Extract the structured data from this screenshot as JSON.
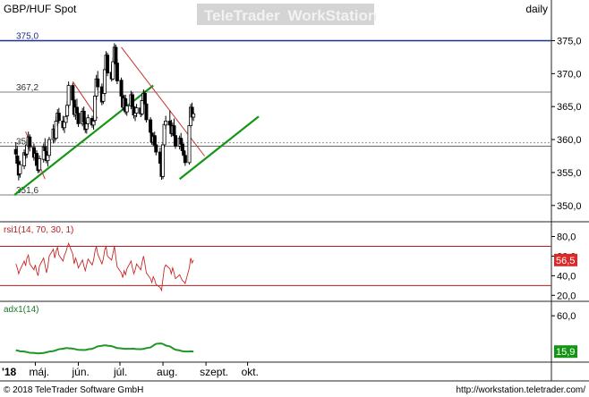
{
  "header": {
    "symbol_title": "GBP/HUF Spot",
    "interval": "daily",
    "watermark_a": "TeleTrader",
    "watermark_b": "WorkStation"
  },
  "footer": {
    "copyright": "© 2018 TeleTrader Software GmbH",
    "url": "http://workstation.teletrader.com/"
  },
  "colors": {
    "candle_up": "#ffffff",
    "candle_down": "#000000",
    "trend_green": "#149614",
    "trend_red": "#c83232",
    "level_blue": "#1f2f8a",
    "level_grey": "#555555",
    "rsi_line": "#c82828",
    "rsi_bounds": "#b41e1e",
    "adx_line": "#1e9628",
    "rsi_badge": "#dc2828",
    "adx_badge": "#149614"
  },
  "chart_data": [
    {
      "type": "candlestick",
      "panel": "price",
      "title": "GBP/HUF Spot",
      "ylim": [
        347.8,
        377.1
      ],
      "y_ticks": [
        "350,0",
        "355,0",
        "360,0",
        "365,0",
        "370,0",
        "375,0"
      ],
      "x_ticks": [
        "'18",
        "máj.",
        "jún.",
        "júl.",
        "aug.",
        "szept.",
        "okt."
      ],
      "level_labels": [
        {
          "value": 375.0,
          "text": "375,0"
        },
        {
          "value": 367.2,
          "text": "367,2"
        },
        {
          "value": 359.0,
          "text": "359"
        },
        {
          "value": 351.6,
          "text": "351,6"
        }
      ],
      "grid_line": 359.5,
      "trendlines": [
        {
          "color": "green",
          "from": [
            "2018-04-16",
            351.6
          ],
          "to": [
            "2018-07-25",
            368.2
          ]
        },
        {
          "color": "green",
          "from": [
            "2018-08-13",
            354.0
          ],
          "to": [
            "2018-10-09",
            363.5
          ]
        },
        {
          "color": "red",
          "from": [
            "2018-04-24",
            361.2
          ],
          "to": [
            "2018-05-08",
            354.0
          ]
        },
        {
          "color": "red",
          "from": [
            "2018-05-28",
            368.8
          ],
          "to": [
            "2018-06-15",
            363.2
          ]
        },
        {
          "color": "red",
          "from": [
            "2018-07-02",
            374.0
          ],
          "to": [
            "2018-08-31",
            357.5
          ]
        }
      ],
      "ohlc": [
        [
          358.5,
          359.6,
          357.2,
          357.8
        ],
        [
          357.5,
          359.0,
          356.0,
          356.4
        ],
        [
          356.6,
          357.5,
          353.8,
          354.6
        ],
        [
          354.8,
          356.8,
          354.2,
          356.2
        ],
        [
          356.0,
          358.5,
          355.5,
          358.0
        ],
        [
          358.0,
          359.2,
          357.0,
          357.6
        ],
        [
          357.8,
          359.8,
          357.2,
          359.2
        ],
        [
          359.0,
          361.2,
          358.5,
          360.4
        ],
        [
          360.4,
          360.8,
          358.2,
          358.9
        ],
        [
          358.8,
          359.4,
          356.8,
          357.3
        ],
        [
          357.2,
          358.6,
          356.0,
          357.9
        ],
        [
          357.9,
          358.4,
          355.6,
          356.1
        ],
        [
          356.0,
          357.2,
          354.9,
          355.3
        ],
        [
          355.4,
          357.6,
          355.0,
          357.1
        ],
        [
          357.0,
          359.4,
          356.5,
          358.9
        ],
        [
          358.8,
          360.2,
          357.8,
          358.3
        ],
        [
          358.2,
          359.0,
          356.4,
          356.8
        ],
        [
          356.8,
          358.2,
          355.9,
          357.6
        ],
        [
          357.6,
          360.4,
          357.2,
          360.0
        ],
        [
          360.0,
          362.3,
          359.4,
          361.6
        ],
        [
          361.5,
          362.0,
          359.6,
          360.2
        ],
        [
          360.2,
          363.4,
          359.9,
          362.8
        ],
        [
          362.8,
          364.6,
          362.0,
          364.0
        ],
        [
          364.0,
          364.8,
          362.4,
          362.9
        ],
        [
          362.8,
          363.6,
          361.4,
          361.8
        ],
        [
          361.8,
          363.2,
          361.0,
          362.7
        ],
        [
          362.6,
          364.0,
          362.0,
          363.5
        ],
        [
          363.6,
          365.8,
          363.0,
          365.2
        ],
        [
          365.2,
          368.8,
          364.8,
          368.2
        ],
        [
          368.2,
          368.6,
          365.6,
          366.0
        ],
        [
          366.0,
          366.6,
          363.4,
          363.8
        ],
        [
          363.8,
          365.4,
          363.0,
          364.9
        ],
        [
          364.9,
          366.2,
          363.6,
          364.0
        ],
        [
          364.0,
          364.6,
          361.9,
          362.4
        ],
        [
          362.4,
          364.8,
          362.0,
          364.3
        ],
        [
          364.3,
          365.0,
          362.2,
          362.6
        ],
        [
          362.6,
          363.4,
          361.0,
          361.5
        ],
        [
          361.6,
          363.0,
          360.9,
          362.4
        ],
        [
          362.4,
          363.8,
          361.9,
          363.3
        ],
        [
          363.2,
          363.6,
          361.8,
          362.2
        ],
        [
          362.2,
          363.4,
          361.5,
          362.8
        ],
        [
          362.9,
          367.0,
          362.5,
          366.6
        ],
        [
          366.6,
          369.8,
          366.0,
          369.2
        ],
        [
          369.2,
          370.4,
          367.5,
          368.0
        ],
        [
          368.0,
          368.5,
          365.2,
          365.7
        ],
        [
          365.8,
          367.4,
          365.4,
          367.0
        ],
        [
          367.0,
          371.2,
          366.6,
          370.6
        ],
        [
          370.6,
          373.4,
          370.0,
          372.8
        ],
        [
          372.8,
          373.2,
          369.6,
          370.1
        ],
        [
          370.2,
          371.4,
          368.8,
          369.2
        ],
        [
          369.2,
          372.4,
          369.0,
          371.8
        ],
        [
          371.8,
          374.6,
          371.4,
          374.0
        ],
        [
          374.0,
          374.4,
          371.0,
          371.5
        ],
        [
          371.6,
          372.2,
          368.4,
          368.9
        ],
        [
          369.0,
          369.4,
          366.2,
          366.6
        ],
        [
          366.6,
          367.0,
          364.4,
          364.9
        ],
        [
          364.8,
          366.8,
          364.4,
          366.3
        ],
        [
          366.2,
          366.8,
          363.8,
          364.2
        ],
        [
          364.2,
          365.6,
          363.6,
          365.1
        ],
        [
          365.1,
          367.4,
          364.6,
          366.8
        ],
        [
          366.8,
          367.2,
          364.6,
          365.0
        ],
        [
          365.0,
          365.8,
          363.2,
          363.7
        ],
        [
          363.6,
          364.4,
          362.8,
          364.0
        ],
        [
          364.0,
          365.4,
          363.4,
          364.8
        ],
        [
          364.8,
          366.0,
          363.4,
          363.9
        ],
        [
          363.9,
          366.4,
          363.6,
          365.9
        ],
        [
          365.9,
          367.6,
          365.4,
          367.0
        ],
        [
          367.0,
          367.4,
          365.0,
          365.4
        ],
        [
          365.4,
          365.8,
          362.6,
          363.0
        ],
        [
          363.0,
          363.4,
          360.6,
          361.1
        ],
        [
          361.0,
          361.6,
          359.2,
          359.6
        ],
        [
          359.6,
          361.0,
          359.0,
          360.5
        ],
        [
          360.6,
          361.2,
          358.8,
          359.2
        ],
        [
          359.2,
          360.4,
          357.6,
          358.1
        ],
        [
          358.1,
          358.8,
          356.0,
          356.4
        ],
        [
          356.4,
          356.9,
          353.9,
          354.4
        ],
        [
          354.4,
          359.6,
          354.0,
          359.2
        ],
        [
          359.2,
          362.8,
          358.8,
          362.3
        ],
        [
          362.2,
          363.6,
          361.6,
          362.8
        ],
        [
          362.8,
          364.4,
          361.8,
          362.2
        ],
        [
          362.2,
          363.0,
          360.4,
          360.9
        ],
        [
          360.9,
          362.6,
          360.5,
          362.1
        ],
        [
          362.1,
          363.2,
          360.2,
          360.6
        ],
        [
          360.6,
          361.4,
          358.6,
          359.0
        ],
        [
          359.0,
          360.6,
          358.5,
          360.2
        ],
        [
          360.2,
          361.0,
          358.8,
          359.3
        ],
        [
          359.3,
          360.0,
          357.8,
          358.3
        ],
        [
          358.3,
          359.4,
          357.2,
          357.6
        ],
        [
          357.6,
          358.2,
          356.0,
          356.5
        ],
        [
          356.5,
          362.6,
          356.2,
          362.1
        ],
        [
          362.1,
          365.4,
          361.8,
          364.9
        ],
        [
          364.9,
          365.6,
          363.0,
          363.4
        ],
        [
          363.4,
          364.2,
          362.8,
          363.9
        ]
      ],
      "first_date": "2018-04-17",
      "last_date": "2018-09-10"
    },
    {
      "type": "line",
      "panel": "rsi",
      "title": "rsi1(14, 70, 30, 1)",
      "ylim": [
        14.8,
        93.2
      ],
      "y_ticks": [
        "20,0",
        "40,0",
        "60,0",
        "80,0"
      ],
      "bounds": [
        70,
        30
      ],
      "last_value": "56,5",
      "values": [
        52,
        48,
        42,
        46,
        55,
        50,
        58,
        61,
        52,
        46,
        51,
        44,
        40,
        50,
        58,
        51,
        43,
        49,
        60,
        67,
        58,
        65,
        69,
        61,
        55,
        61,
        64,
        69,
        73,
        62,
        52,
        58,
        54,
        48,
        56,
        50,
        45,
        51,
        57,
        51,
        56,
        65,
        70,
        62,
        52,
        57,
        66,
        70,
        60,
        56,
        63,
        70,
        59,
        49,
        43,
        38,
        45,
        41,
        47,
        55,
        48,
        42,
        46,
        52,
        46,
        54,
        60,
        52,
        43,
        37,
        33,
        39,
        36,
        31,
        28,
        25,
        37,
        48,
        51,
        47,
        42,
        48,
        43,
        37,
        41,
        38,
        35,
        34,
        32,
        48,
        58,
        53,
        56
      ]
    },
    {
      "type": "line",
      "panel": "adx",
      "title": "adx1(14)",
      "ylim": [
        4.0,
        75.6
      ],
      "y_ticks": [
        "60,0"
      ],
      "last_value": "15,9",
      "values": [
        17.5,
        17.2,
        16.8,
        16.3,
        16.0,
        15.6,
        15.2,
        14.8,
        14.5,
        14.2,
        14.0,
        13.8,
        13.6,
        13.8,
        14.2,
        14.6,
        15.0,
        15.4,
        15.9,
        16.5,
        17.0,
        17.6,
        18.2,
        18.8,
        19.4,
        19.8,
        20.1,
        20.3,
        20.0,
        19.6,
        19.2,
        18.8,
        18.4,
        18.1,
        17.9,
        17.8,
        17.9,
        18.2,
        18.7,
        19.3,
        20.0,
        20.8,
        21.6,
        22.4,
        23.0,
        23.4,
        23.6,
        23.5,
        23.1,
        22.6,
        22.0,
        21.4,
        20.8,
        20.3,
        19.9,
        19.6,
        19.4,
        19.3,
        19.3,
        19.4,
        19.5,
        19.4,
        19.2,
        19.0,
        18.9,
        19.0,
        19.3,
        19.7,
        20.2,
        21.0,
        22.0,
        23.2,
        24.4,
        25.4,
        25.9,
        25.8,
        25.2,
        24.4,
        23.4,
        22.3,
        21.2,
        20.1,
        19.1,
        18.2,
        17.4,
        16.8,
        16.4,
        16.2,
        16.0,
        16.1,
        16.2,
        16.1,
        15.9
      ]
    }
  ]
}
